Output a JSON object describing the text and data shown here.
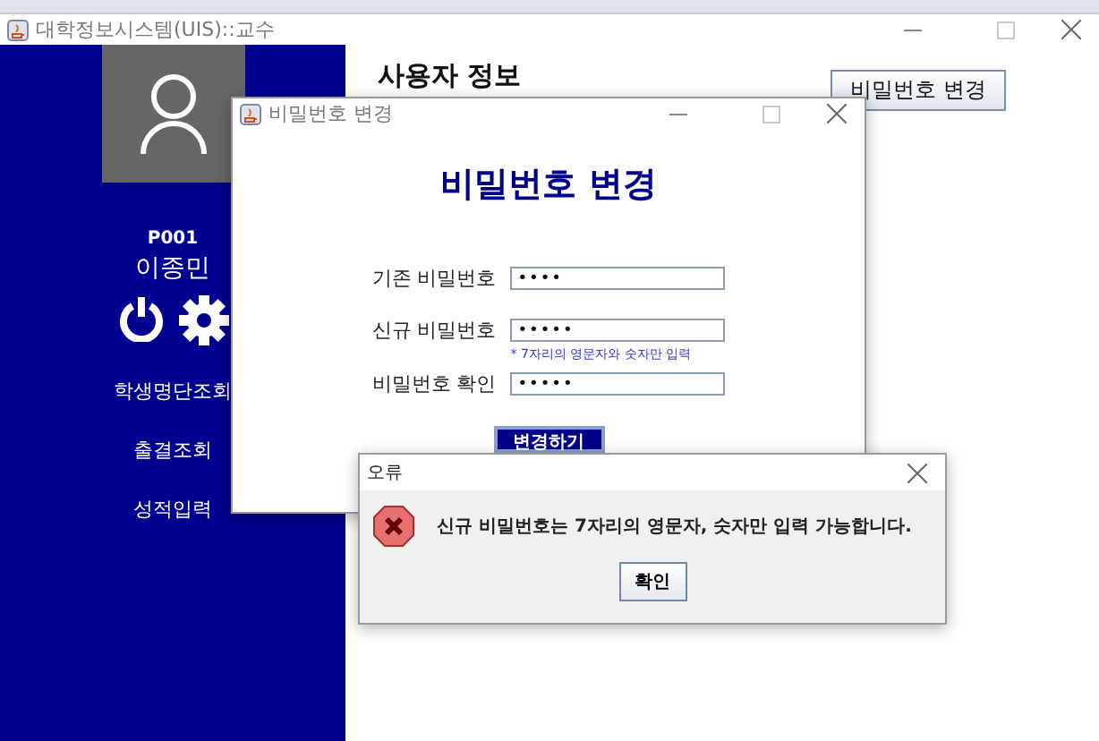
{
  "window": {
    "title": "대학정보시스템(UIS)::교수"
  },
  "sidebar": {
    "user_id": "P001",
    "user_name": "이종민",
    "menu": [
      "학생명단조회",
      "출결조회",
      "성적입력"
    ]
  },
  "content": {
    "heading": "사용자 정보",
    "change_password_button": "비밀번호 변경"
  },
  "password_dialog": {
    "title": "비밀번호 변경",
    "heading": "비밀번호 변경",
    "fields": [
      {
        "label": "기존 비밀번호",
        "value": "••••"
      },
      {
        "label": "신규 비밀번호",
        "value": "•••••",
        "hint": "* 7자리의 영문자와 숫자만 입력"
      },
      {
        "label": "비밀번호 확인",
        "value": "•••••"
      }
    ],
    "submit": "변경하기"
  },
  "error_dialog": {
    "title": "오류",
    "message": "신규 비밀번호는 7자리의 영문자, 숫자만 입력 가능합니다.",
    "ok": "확인"
  }
}
